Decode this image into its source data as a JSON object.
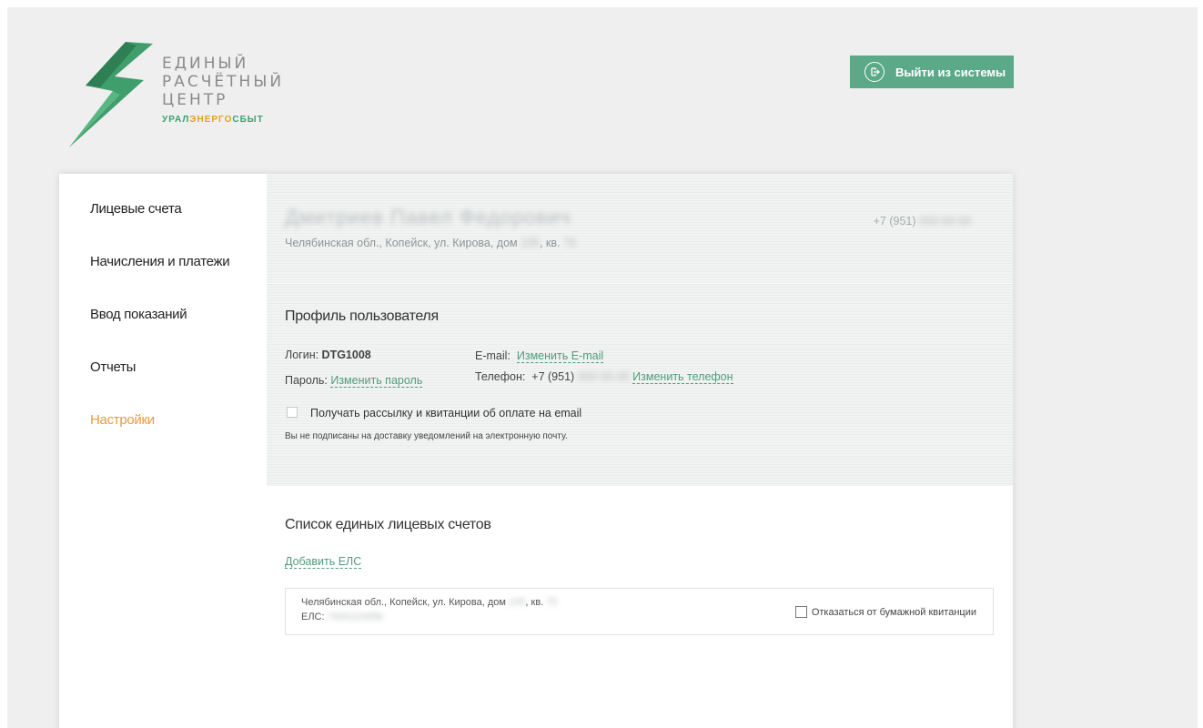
{
  "logo": {
    "lines": [
      "ЕДИНЫЙ",
      "РАСЧЁТНЫЙ",
      "ЦЕНТР"
    ],
    "sub_green": "УРАЛ",
    "sub_yellow": "ЭНЕРГО",
    "sub_green2": "СБЫТ",
    "colors": {
      "green": "#3aa26e",
      "yellow": "#e2a21d"
    }
  },
  "header": {
    "logout_label": "Выйти из системы",
    "logout_icon_glyph": "⏎"
  },
  "sidebar": {
    "items": [
      {
        "label": "Лицевые счета"
      },
      {
        "label": "Начисления и платежи"
      },
      {
        "label": "Ввод показаний"
      },
      {
        "label": "Отчеты"
      },
      {
        "label": "Настройки",
        "active": true
      }
    ]
  },
  "user": {
    "name": "Дмитриев Павел Федорович",
    "address_prefix": "Челябинская обл., Копейск, ул. Кирова, дом ",
    "address_house": "105",
    "address_apt_prefix": ", кв. ",
    "address_apt": "75",
    "phone_prefix": "+7 (951) ",
    "phone_hidden": "000-00-00"
  },
  "profile": {
    "title": "Профиль пользователя",
    "login_label": "Логин: ",
    "login_value": "DTG1008",
    "password_label": "Пароль: ",
    "change_password": "Изменить пароль",
    "email_label": "E-mail:",
    "change_email": "Изменить E-mail",
    "phone_label": "Телефон:",
    "phone_prefix": "+7 (951)",
    "phone_hidden": "000-00-00",
    "change_phone": "Изменить телефон",
    "subscribe_label": "Получать рассылку и квитанции об оплате на email",
    "subscribe_note": "Вы не подписаны на доставку уведомлений на электронную почту."
  },
  "els": {
    "title": "Список единых лицевых счетов",
    "add_label": "Добавить ЕЛС",
    "items": [
      {
        "address_prefix": "Челябинская обл., Копейск, ул. Кирова, дом ",
        "address_house": "105",
        "address_apt_prefix": ", кв. ",
        "address_apt": "75",
        "els_label": "ЕЛС: ",
        "els_number": "7400123456",
        "refuse_label": "Отказаться от бумажной квитанции"
      }
    ]
  }
}
